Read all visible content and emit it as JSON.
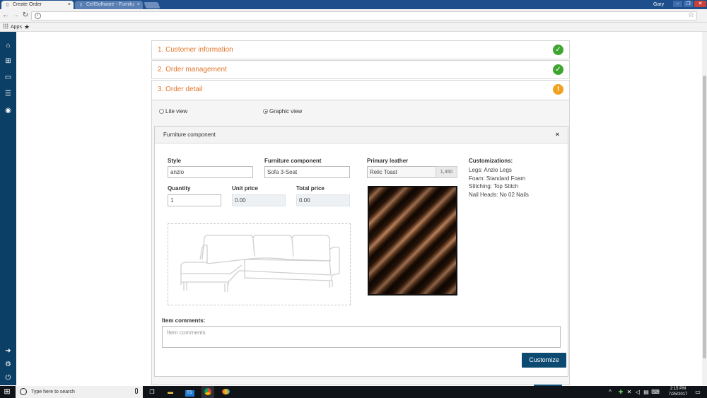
{
  "browser": {
    "tabs": [
      {
        "title": "Create Order",
        "active": true
      },
      {
        "title": "CellSoftware - Furnitu",
        "active": false
      }
    ],
    "user": "Gary",
    "bookmarks": {
      "apps_label": "Apps"
    }
  },
  "steps": [
    {
      "label": "1. Customer information",
      "status": "complete"
    },
    {
      "label": "2. Order management",
      "status": "complete"
    },
    {
      "label": "3. Order detail",
      "status": "warning"
    }
  ],
  "status_glyphs": {
    "complete": "✓",
    "warning": "!"
  },
  "view_options": {
    "lite": "Lite view",
    "graphic": "Graphic view",
    "selected": "graphic"
  },
  "component": {
    "header": "Furniture component",
    "close_glyph": "×",
    "style": {
      "label": "Style",
      "value": "anzio"
    },
    "furniture_component": {
      "label": "Furniture component",
      "value": "Sofa 3-Seat"
    },
    "quantity": {
      "label": "Quantity",
      "value": "1"
    },
    "unit_price": {
      "label": "Unit price",
      "value": "0.00"
    },
    "total_price": {
      "label": "Total price",
      "value": "0.00"
    },
    "primary_leather": {
      "label": "Primary leather",
      "value": "Relic Toast",
      "code": "1,450"
    },
    "customizations": {
      "label": "Customizations:",
      "items": [
        "Legs: Anzio Legs",
        "Foam: Standard Foam",
        "Stitching: Top Stitch",
        "Nail Heads: No 02 Nails"
      ]
    },
    "item_comments": {
      "label": "Item comments:",
      "placeholder": "Item comments"
    },
    "customize_button": "Customize"
  },
  "taskbar": {
    "search_placeholder": "Type here to search",
    "time": "2:15 PM",
    "date": "7/25/2017"
  },
  "colors": {
    "accent_orange": "#e2762b",
    "ok_green": "#3fa531",
    "warn_orange": "#f0a21f",
    "primary_navy": "#0d4a72",
    "sidebar_navy": "#0b3f66"
  }
}
